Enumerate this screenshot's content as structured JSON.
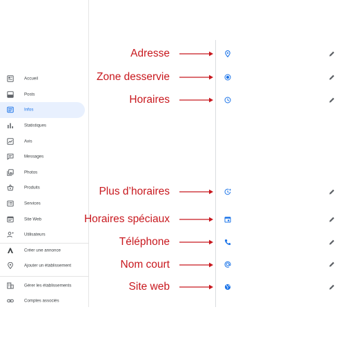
{
  "sidebar": {
    "items": [
      {
        "label": "Accueil",
        "icon": "home-icon"
      },
      {
        "label": "Posts",
        "icon": "posts-icon"
      },
      {
        "label": "Infos",
        "icon": "info-icon",
        "active": true
      },
      {
        "label": "Statistiques",
        "icon": "stats-icon"
      },
      {
        "label": "Avis",
        "icon": "reviews-icon"
      },
      {
        "label": "Messages",
        "icon": "messages-icon"
      },
      {
        "label": "Photos",
        "icon": "photos-icon"
      },
      {
        "label": "Produits",
        "icon": "products-icon"
      },
      {
        "label": "Services",
        "icon": "services-icon"
      },
      {
        "label": "Site Web",
        "icon": "website-icon"
      },
      {
        "label": "Utilisateurs",
        "icon": "users-icon"
      }
    ],
    "actions": [
      {
        "label": "Créer une annonce",
        "icon": "ads-icon"
      },
      {
        "label": "Ajouter un établissement",
        "icon": "add-location-icon"
      }
    ],
    "footer": [
      {
        "label": "Gérer les établissements",
        "icon": "manage-locations-icon"
      },
      {
        "label": "Comptes associés",
        "icon": "linked-accounts-icon"
      }
    ]
  },
  "annotations": [
    {
      "label": "Adresse",
      "icon": "location-pin-icon"
    },
    {
      "label": "Zone desservie",
      "icon": "service-area-icon"
    },
    {
      "label": "Horaires",
      "icon": "clock-icon"
    },
    {
      "label": "Plus d’horaires",
      "icon": "more-hours-icon"
    },
    {
      "label": "Horaires spéciaux",
      "icon": "calendar-icon"
    },
    {
      "label": "Téléphone",
      "icon": "phone-icon"
    },
    {
      "label": "Nom court",
      "icon": "at-sign-icon"
    },
    {
      "label": "Site web",
      "icon": "globe-icon"
    }
  ],
  "colors": {
    "annotation": "#c8181e",
    "accent": "#1a73e8",
    "active_bg": "#e8f0fe",
    "sidebar_text": "#3c4043"
  }
}
